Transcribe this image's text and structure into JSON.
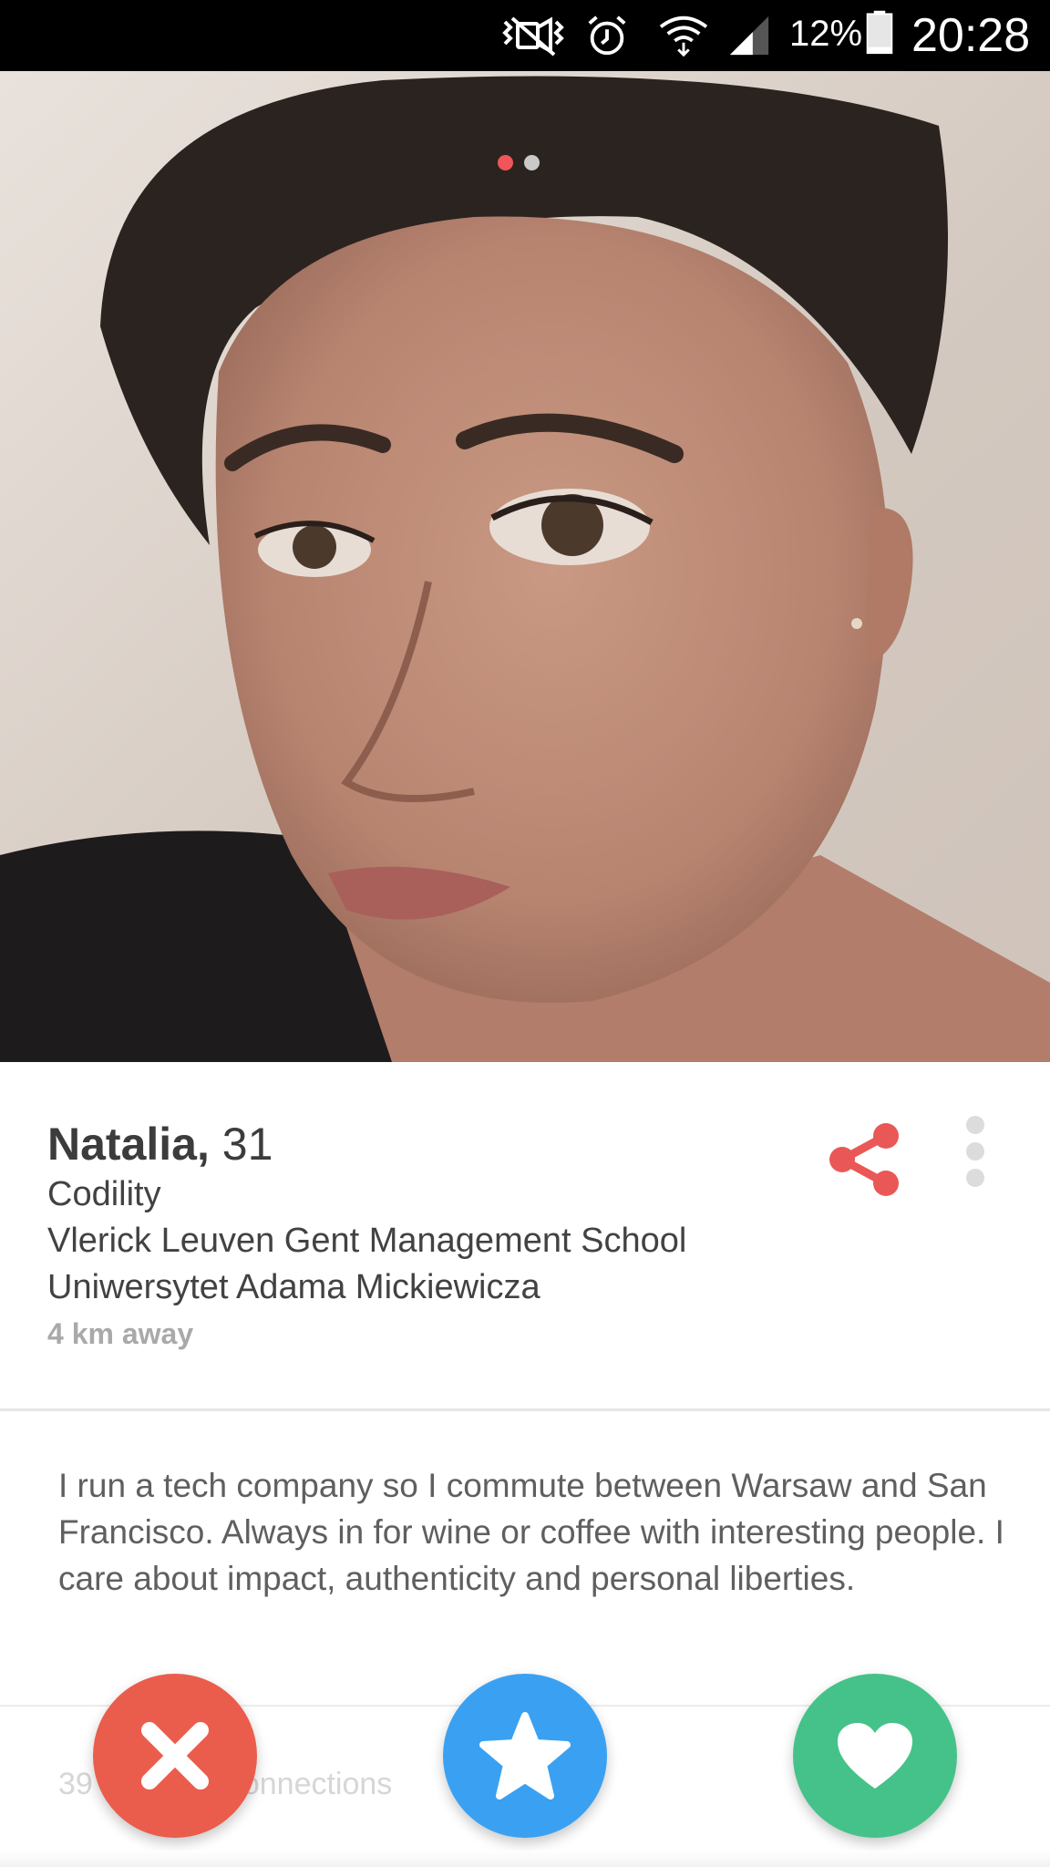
{
  "status_bar": {
    "battery_percent": "12%",
    "time": "20:28",
    "icons": [
      "mute-icon",
      "alarm-icon",
      "wifi-icon",
      "signal-icon",
      "battery-icon"
    ]
  },
  "photo": {
    "page_indicator": {
      "count": 2,
      "active_index": 0
    },
    "colors": {
      "active_dot": "#f0555a",
      "inactive_dot": "#c9c9c9"
    }
  },
  "profile": {
    "name": "Natalia,",
    "age": "31",
    "job": "Codility",
    "schools": [
      "Vlerick Leuven Gent Management School",
      "Uniwersytet Adama Mickiewicza"
    ],
    "distance": "4 km away"
  },
  "bio": "I run a tech company so I commute between Warsaw and San Francisco. Always in for wine or coffee with interesting people. I care about impact, authenticity and personal liberties.",
  "connections": {
    "count": "39",
    "label": "Connections"
  },
  "actions": {
    "nope_icon": "close-icon",
    "super_like_icon": "star-icon",
    "like_icon": "heart-icon"
  },
  "colors": {
    "share": "#ea5757",
    "nope": "#ea5d4d",
    "super_like": "#3aa1f2",
    "like": "#45c289"
  }
}
